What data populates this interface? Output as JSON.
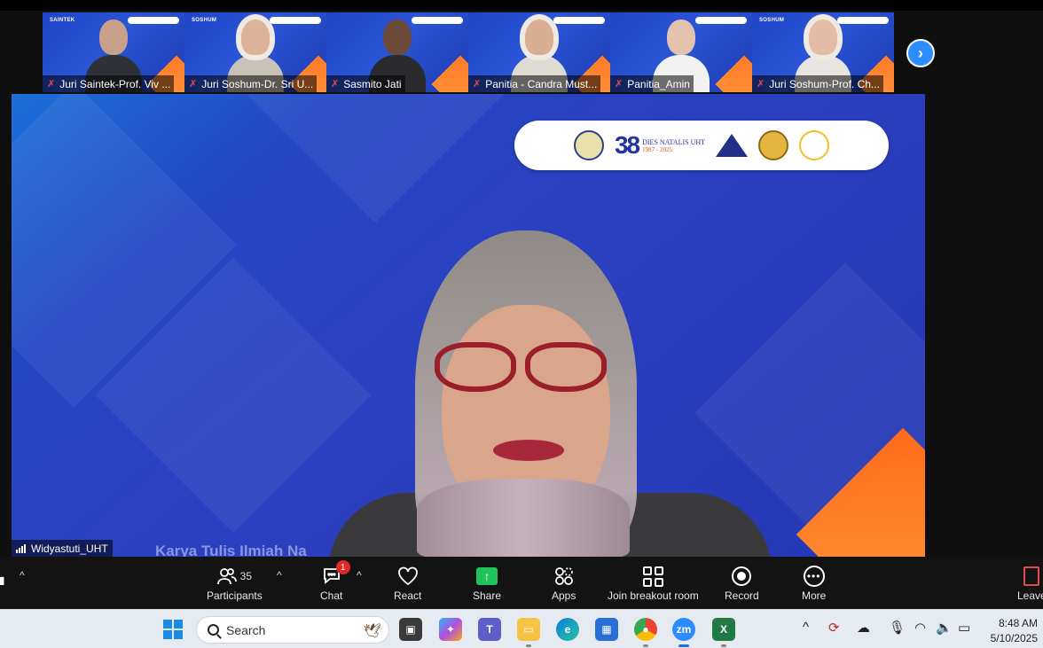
{
  "thumbnails": [
    {
      "name": "Juri Saintek-Prof. Viv ...",
      "tag": "SAINTEK",
      "skin": "#c9a08a",
      "body": "#2f3138",
      "hijab": false
    },
    {
      "name": "Juri Soshum-Dr. Sri U...",
      "tag": "SOSHUM",
      "skin": "#dcb29a",
      "body": "#c7c1b8",
      "hijab": true
    },
    {
      "name": "Sasmito Jati",
      "tag": "",
      "skin": "#6e4a3a",
      "body": "#2b2b2f",
      "hijab": false
    },
    {
      "name": "Panitia - Candra Must...",
      "tag": "",
      "skin": "#d8ad92",
      "body": "#dedad4",
      "hijab": true
    },
    {
      "name": "Panitia_Amin",
      "tag": "",
      "skin": "#e4c2ae",
      "body": "#f2f2f2",
      "hijab": false
    },
    {
      "name": "Juri Soshum-Prof. Ch...",
      "tag": "SOSHUM",
      "skin": "#e2bca6",
      "body": "#e8e4e0",
      "hijab": true
    }
  ],
  "main": {
    "speaker_name": "Widyastuti_UHT",
    "caption_behind": "Karya Tulis Ilmiah Na",
    "banner": {
      "number": "38",
      "title": "DIES NATALIS UHT",
      "years": "1987 - 2025"
    }
  },
  "toolbar": {
    "participants_label": "Participants",
    "participants_count": "35",
    "chat_label": "Chat",
    "chat_badge": "1",
    "react_label": "React",
    "share_label": "Share",
    "apps_label": "Apps",
    "breakout_label": "Join breakout room",
    "record_label": "Record",
    "more_label": "More",
    "leave_label": "Leave"
  },
  "taskbar": {
    "search_placeholder": "Search",
    "time": "8:48 AM",
    "date": "5/10/2025"
  },
  "colors": {
    "zoom_blue": "#2d8cff",
    "share_green": "#1ec45a",
    "badge_red": "#e02828",
    "mic_off_red": "#e5484d"
  }
}
